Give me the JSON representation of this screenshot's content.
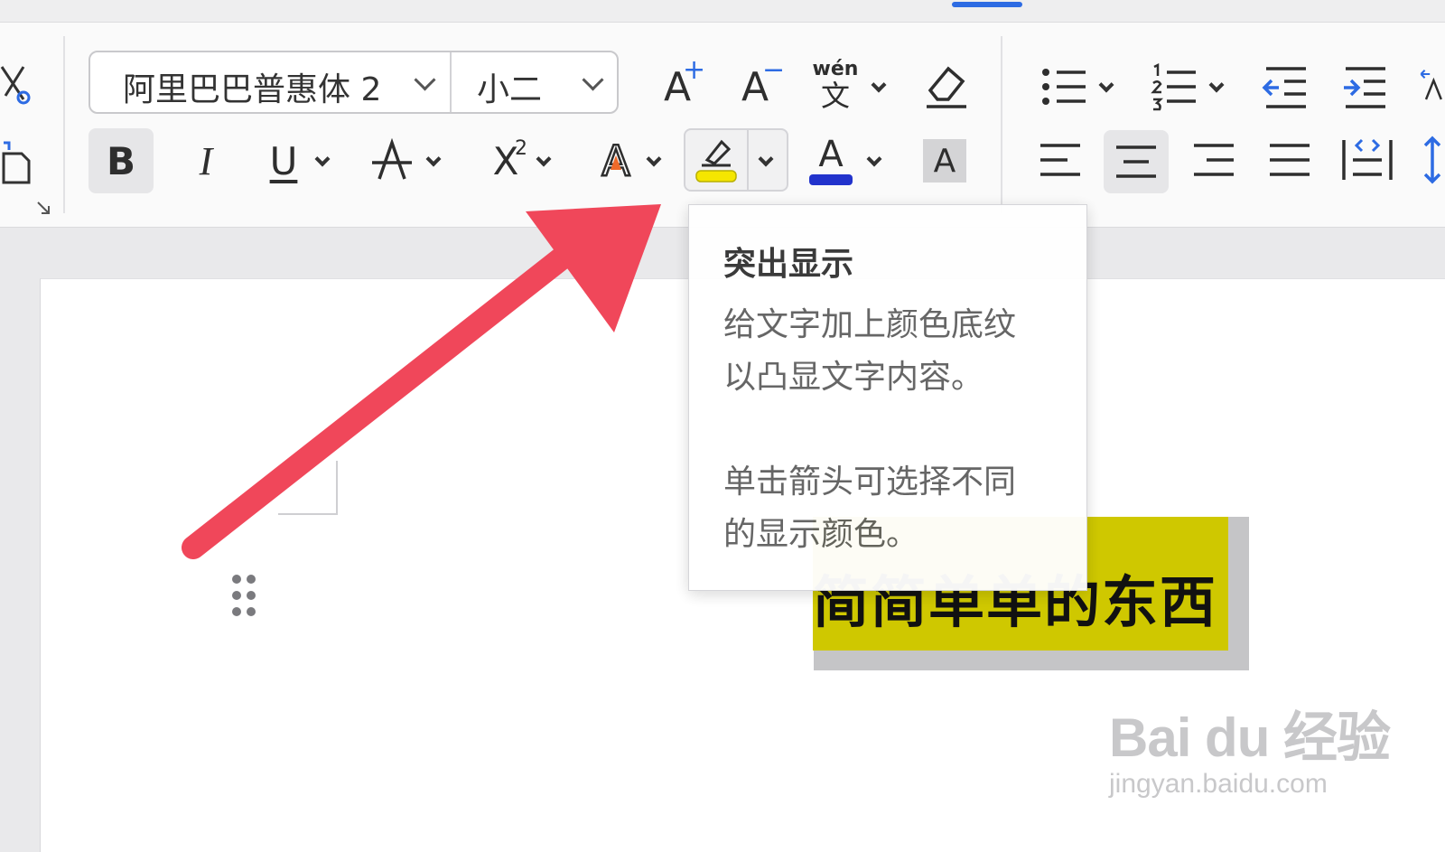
{
  "font_group": {
    "font_name": "阿里巴巴普惠体 2",
    "font_size": "小二"
  },
  "buttons": {
    "bold": "B",
    "italic": "I",
    "underline": "U",
    "superscript_base": "X",
    "superscript_exp": "2",
    "text_effect": "A",
    "font_color": "A",
    "char_shading": "A",
    "pinyin_top": "wén",
    "pinyin_bottom": "文",
    "grow_font": "A",
    "grow_plus": "+",
    "shrink_font": "A",
    "shrink_minus": "−"
  },
  "colors": {
    "highlight_yellow": "#f5e600",
    "font_color_blue": "#2233cc",
    "accent_arrow": "#f0475a",
    "tab_indicator": "#2d6be3"
  },
  "tooltip": {
    "title": "突出显示",
    "line1": "给文字加上颜色底纹",
    "line2": "以凸显文字内容。",
    "line3": "单击箭头可选择不同",
    "line4": "的显示颜色。"
  },
  "document": {
    "highlighted_text": "简简单单的东西"
  },
  "watermark": {
    "logo": "Bai du 经验",
    "url": "jingyan.baidu.com"
  }
}
